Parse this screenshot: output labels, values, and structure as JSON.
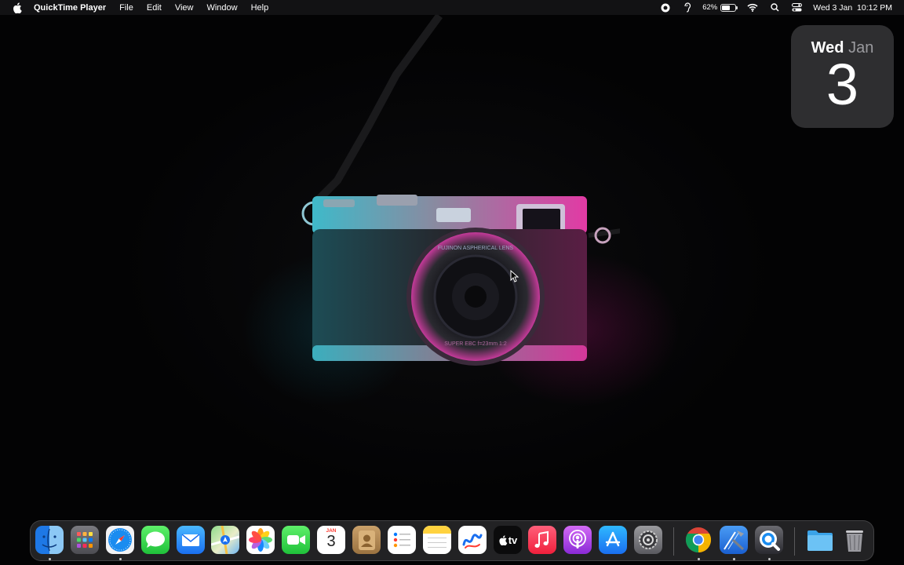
{
  "menubar": {
    "app_name": "QuickTime Player",
    "menus": [
      "File",
      "Edit",
      "Window",
      "View",
      "Help"
    ],
    "menu_order": [
      "File",
      "Edit",
      "View",
      "Window",
      "Help"
    ],
    "battery_percent": "62%",
    "battery_level": 0.62,
    "datetime": "Wed 3 Jan  10:12 PM",
    "status_icons": [
      "screen-recording-icon",
      "accessibility-icon",
      "battery-icon",
      "wifi-icon",
      "spotlight-search-icon",
      "control-center-icon"
    ]
  },
  "widget": {
    "day": "Wed",
    "month": "Jan",
    "date": "3"
  },
  "dock": {
    "apps": [
      {
        "name": "finder-icon",
        "running": true
      },
      {
        "name": "launchpad-icon",
        "running": false
      },
      {
        "name": "safari-icon",
        "running": true
      },
      {
        "name": "messages-icon",
        "running": false
      },
      {
        "name": "mail-icon",
        "running": false
      },
      {
        "name": "maps-icon",
        "running": false
      },
      {
        "name": "photos-icon",
        "running": false
      },
      {
        "name": "facetime-icon",
        "running": false
      },
      {
        "name": "calendar-icon",
        "running": false,
        "month": "JAN",
        "day": "3"
      },
      {
        "name": "contacts-icon",
        "running": false
      },
      {
        "name": "reminders-icon",
        "running": false
      },
      {
        "name": "notes-icon",
        "running": false
      },
      {
        "name": "freeform-icon",
        "running": false
      },
      {
        "name": "apple-tv-icon",
        "running": false,
        "label": "tv"
      },
      {
        "name": "music-icon",
        "running": false
      },
      {
        "name": "podcasts-icon",
        "running": false
      },
      {
        "name": "app-store-icon",
        "running": false
      },
      {
        "name": "system-settings-icon",
        "running": false
      },
      {
        "name": "chrome-icon",
        "running": true
      },
      {
        "name": "xcode-icon",
        "running": true
      },
      {
        "name": "quicktime-player-icon",
        "running": true
      },
      {
        "name": "downloads-folder-icon",
        "running": false
      },
      {
        "name": "trash-icon",
        "running": false
      }
    ]
  },
  "wallpaper": {
    "subject": "camera",
    "lens_text_top": "FUJINON ASPHERICAL LENS",
    "lens_text_bottom": "SUPER EBC  f=23mm 1:2"
  },
  "colors": {
    "menubar_bg": "#141416",
    "accent_pink": "#d21c8c",
    "accent_cyan": "#14a0be"
  }
}
